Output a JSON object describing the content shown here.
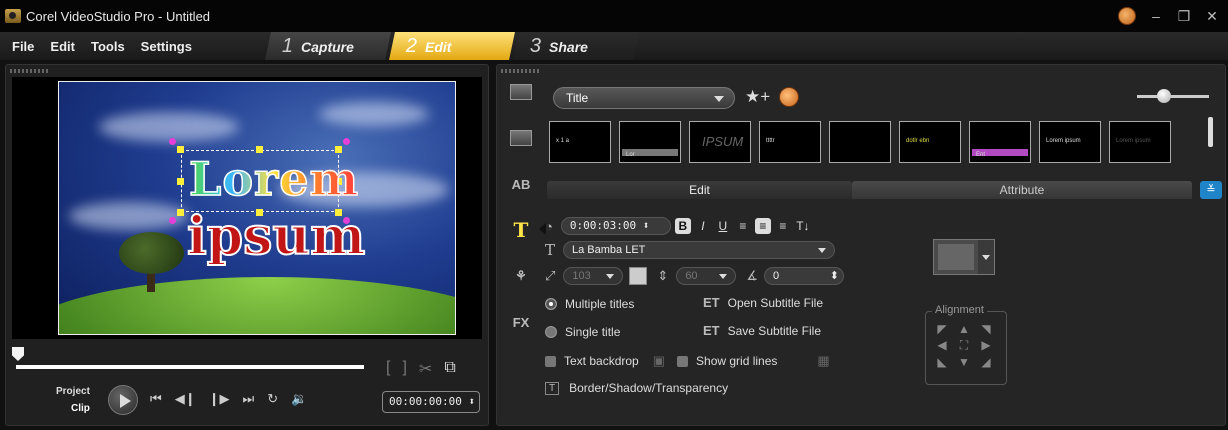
{
  "window": {
    "title": "Corel VideoStudio Pro - Untitled"
  },
  "menu": [
    "File",
    "Edit",
    "Tools",
    "Settings"
  ],
  "steps": [
    {
      "num": "1",
      "label": "Capture"
    },
    {
      "num": "2",
      "label": "Edit"
    },
    {
      "num": "3",
      "label": "Share"
    }
  ],
  "preview": {
    "title_line1": "Lorem",
    "title_line2": "ipsum"
  },
  "player": {
    "project_label": "Project",
    "clip_label": "Clip",
    "timecode": "00:00:00:00"
  },
  "library": {
    "category": "Title",
    "thumbs": [
      {
        "kind": "text",
        "text": "x  1  a"
      },
      {
        "kind": "bar",
        "text": "Lor",
        "bar_color": "#777777"
      },
      {
        "kind": "ipsum",
        "text": "IPSUM"
      },
      {
        "kind": "text",
        "text": "ttttr"
      },
      {
        "kind": "blank",
        "text": ""
      },
      {
        "kind": "text",
        "text": "dotlr ebn"
      },
      {
        "kind": "bar",
        "text": "Ent",
        "bar_color": "#b24bc2"
      },
      {
        "kind": "text",
        "text": "Lorem ipsum"
      },
      {
        "kind": "text",
        "text": "Lorem ipsum"
      }
    ]
  },
  "tabs": {
    "edit": "Edit",
    "attribute": "Attribute"
  },
  "edit": {
    "duration": "0:00:03:00",
    "font": "La Bamba LET",
    "font_size": "103",
    "line_spacing": "60",
    "angle": "0",
    "multiple_titles": "Multiple titles",
    "single_title": "Single title",
    "text_backdrop": "Text backdrop",
    "show_grid_lines": "Show grid lines",
    "open_subtitle": "Open Subtitle File",
    "save_subtitle": "Save Subtitle File",
    "border_shadow": "Border/Shadow/Transparency",
    "alignment": "Alignment"
  },
  "side_tabs": [
    "media",
    "transition",
    "AB",
    "T",
    "graphic",
    "FX"
  ]
}
